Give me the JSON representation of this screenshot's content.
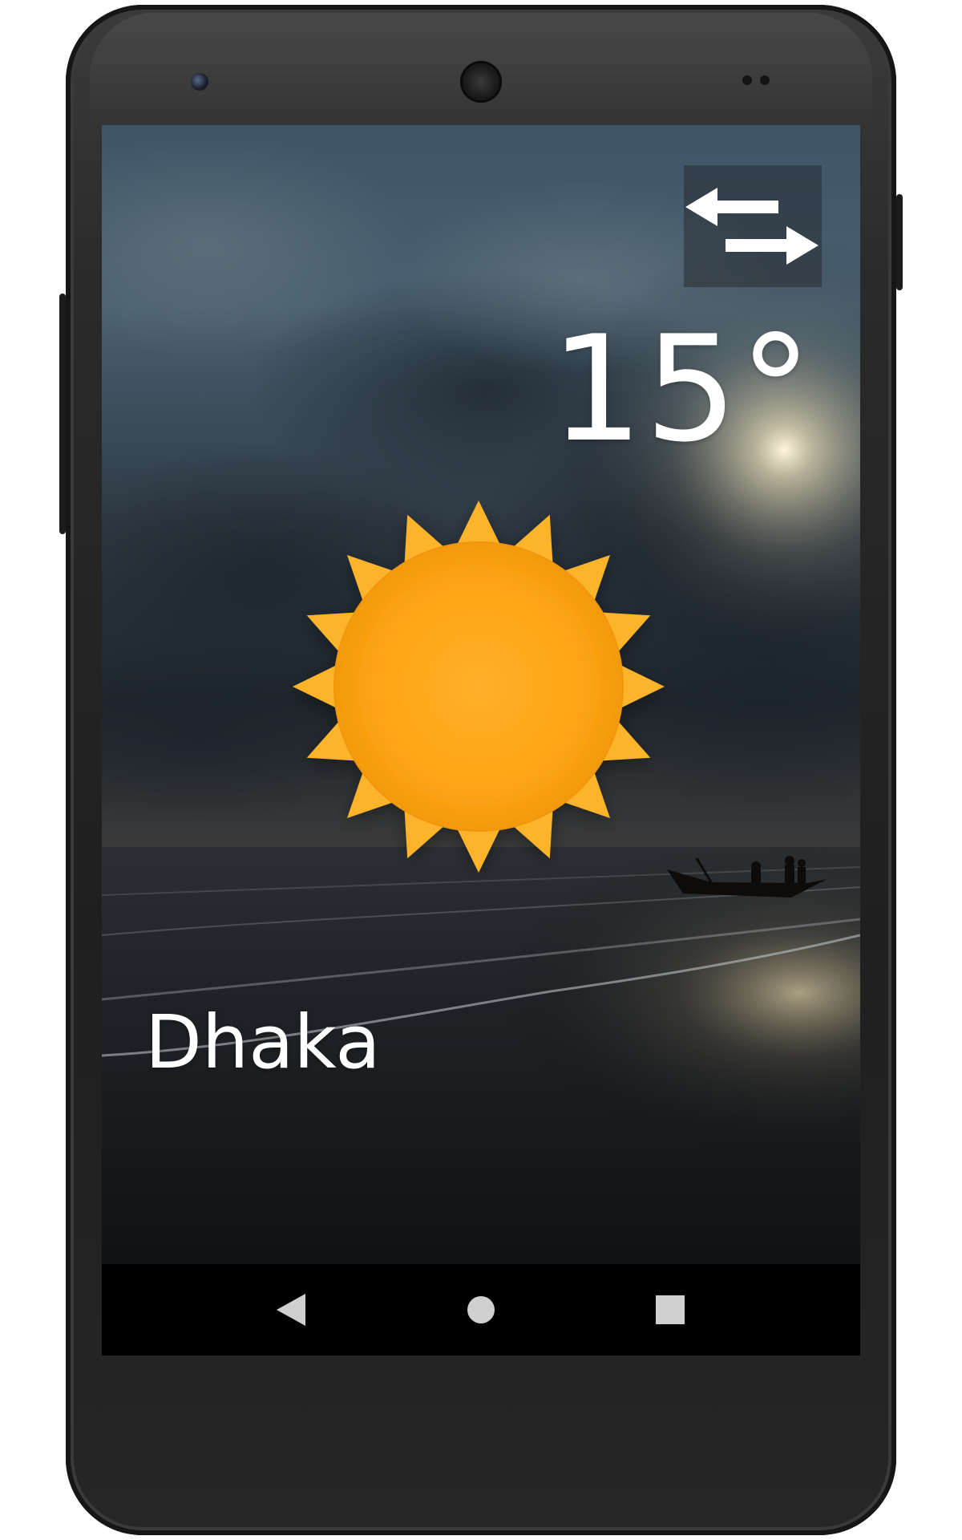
{
  "weather": {
    "temperature": "15°",
    "city": "Dhaka",
    "condition_icon": "sun-icon"
  },
  "toolbar": {
    "switch_icon": "swap-arrows-icon"
  },
  "navbar": {
    "back_icon": "back-triangle-icon",
    "home_icon": "home-circle-icon",
    "recents_icon": "recents-square-icon"
  },
  "colors": {
    "sun_core": "#ffa414",
    "sun_rays": "#fdb32a",
    "text": "#ffffff",
    "navbar": "#000000"
  }
}
